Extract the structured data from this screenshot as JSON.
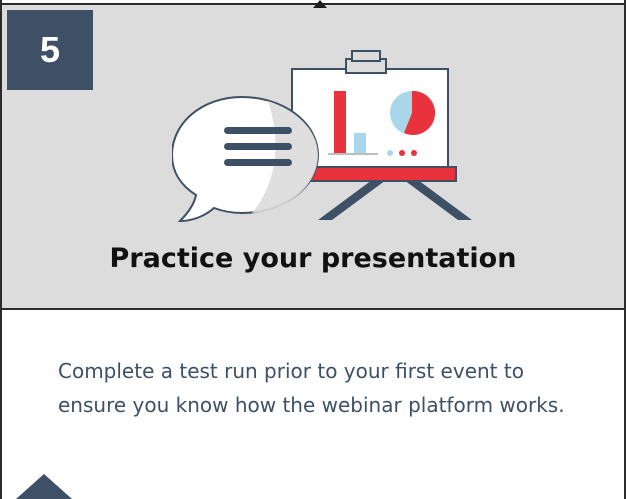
{
  "step": {
    "number": "5"
  },
  "card": {
    "title": "Practice your presentation",
    "description": "Complete a test run prior to your first event to ensure you know how the webinar platform works."
  },
  "illustration": {
    "icon": "presentation-easel-with-speech-bubble-icon"
  },
  "colors": {
    "panel_bg": "#dcdcdc",
    "badge_bg": "#3d5065",
    "text_accent": "#3d5065",
    "chart_red": "#e8323c",
    "chart_blue": "#a9d7ea",
    "border": "#2b2b2b"
  }
}
